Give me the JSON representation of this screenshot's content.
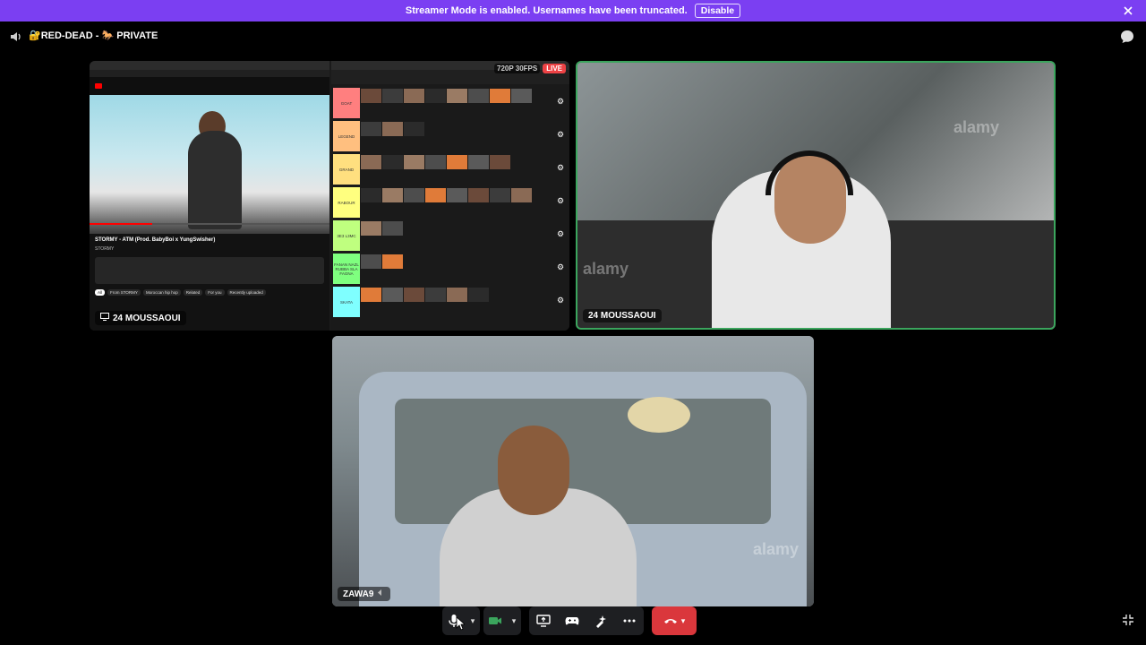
{
  "banner": {
    "message": "Streamer Mode is enabled. Usernames have been truncated.",
    "disable_label": "Disable",
    "background_color": "#7b3ff2"
  },
  "header": {
    "title": "🔐RED-DEAD - 🐎 PRIVATE"
  },
  "tiles": {
    "screen_share": {
      "label": "24 MOUSSAOUI",
      "quality": "720P 30FPS",
      "live": "LIVE",
      "youtube": {
        "title": "STORMY - ATM (Prod. BabyBoi x YungSwisher)",
        "channel": "STORMY",
        "tags": [
          "All",
          "From STORMY",
          "Moroccan hip hop",
          "Related",
          "For you",
          "Recently uploaded"
        ]
      },
      "tier_rows": [
        {
          "label": "GOAT",
          "color": "#ff7f7f"
        },
        {
          "label": "LEGEND",
          "color": "#ffbf7f"
        },
        {
          "label": "GRAND",
          "color": "#ffdf7f"
        },
        {
          "label": "RABOUR",
          "color": "#ffff7f"
        },
        {
          "label": "3E3 L3MC",
          "color": "#bfff7f"
        },
        {
          "label": "FANAN NAZL RUBBA SLA FAGNA",
          "color": "#7fff7f"
        },
        {
          "label": "SKATA",
          "color": "#7fffff"
        }
      ]
    },
    "cam1": {
      "label": "24 MOUSSAOUI",
      "speaking_border": "#3ba55d",
      "watermark": "alamy"
    },
    "cam2": {
      "label": "ZAWA9",
      "watermark": "alamy"
    }
  },
  "controls": {
    "end_call_color": "#da373c"
  }
}
